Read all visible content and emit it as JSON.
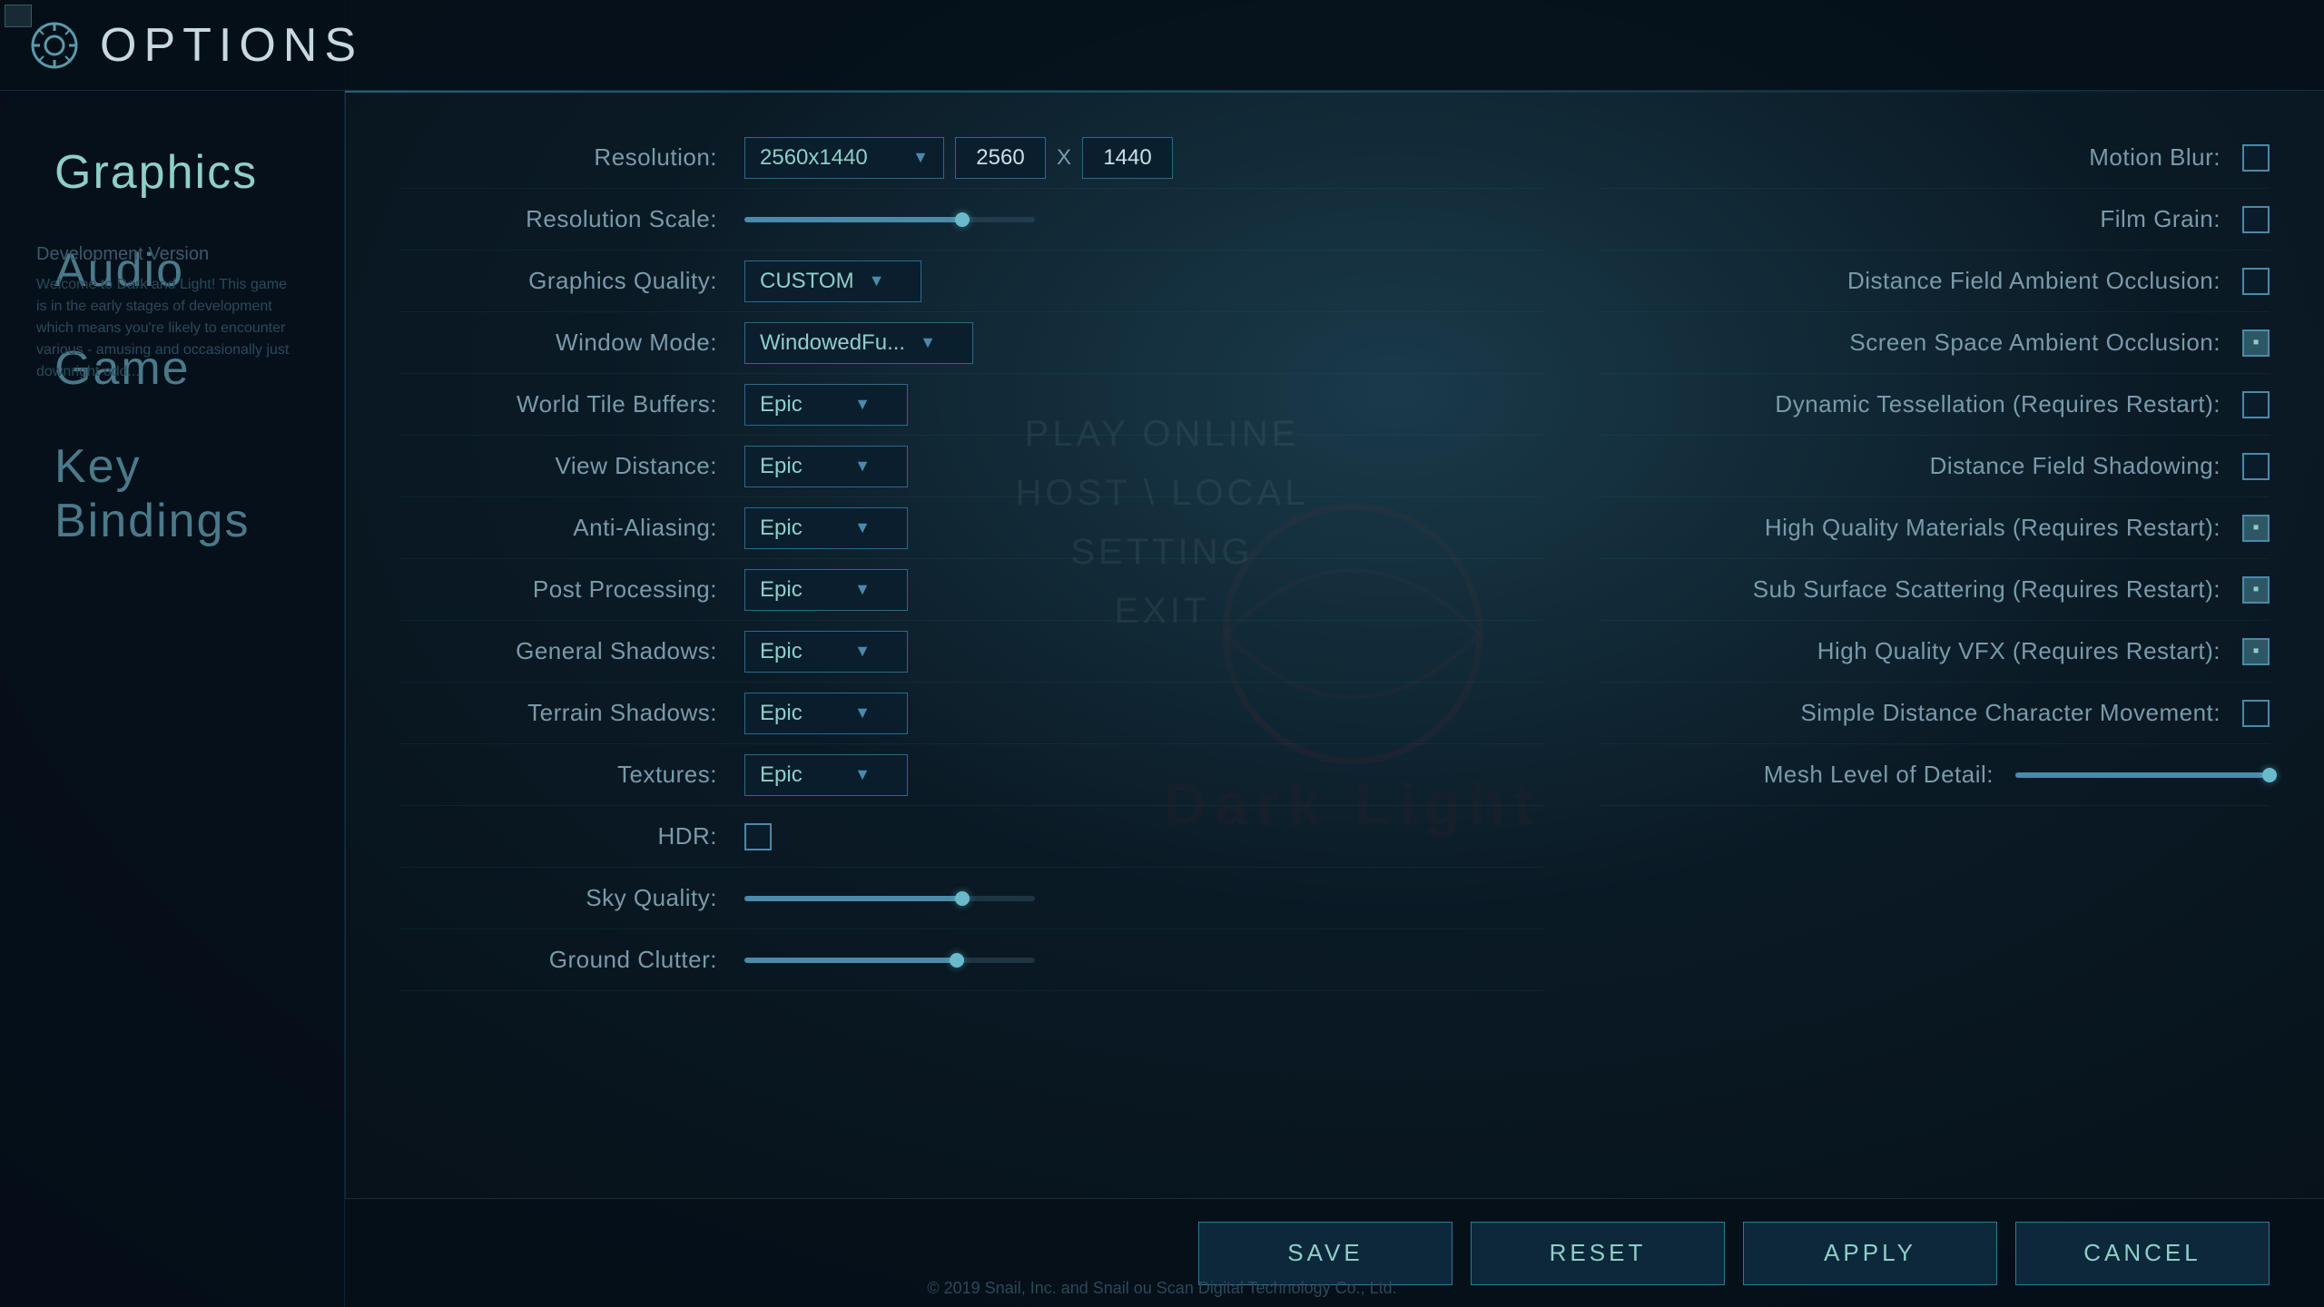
{
  "window": {
    "title": "OPTIONS",
    "icon": "⚙"
  },
  "sidebar": {
    "items": [
      {
        "id": "graphics",
        "label": "Graphics",
        "active": true
      },
      {
        "id": "audio",
        "label": "Audio",
        "active": false
      },
      {
        "id": "game",
        "label": "Game",
        "active": false
      },
      {
        "id": "keybindings",
        "label": "Key Bindings",
        "active": false
      }
    ],
    "dev_note_title": "Development Version",
    "dev_note_body": "Welcome to Dark and Light! This game is in the early stages of development which means you're likely to encounter various - amusing and occasionally just downright odd..."
  },
  "settings_left": {
    "resolution": {
      "label": "Resolution:",
      "dropdown_value": "2560x1440",
      "width": "2560",
      "x_sep": "X",
      "height": "1440"
    },
    "resolution_scale": {
      "label": "Resolution Scale:",
      "slider_pct": 75
    },
    "graphics_quality": {
      "label": "Graphics Quality:",
      "value": "CUSTOM"
    },
    "window_mode": {
      "label": "Window Mode:",
      "value": "WindowedFu..."
    },
    "world_tile_buffers": {
      "label": "World Tile Buffers:",
      "value": "Epic"
    },
    "view_distance": {
      "label": "View Distance:",
      "value": "Epic"
    },
    "anti_aliasing": {
      "label": "Anti-Aliasing:",
      "value": "Epic"
    },
    "post_processing": {
      "label": "Post Processing:",
      "value": "Epic"
    },
    "general_shadows": {
      "label": "General Shadows:",
      "value": "Epic"
    },
    "terrain_shadows": {
      "label": "Terrain Shadows:",
      "value": "Epic"
    },
    "textures": {
      "label": "Textures:",
      "value": "Epic"
    },
    "hdr": {
      "label": "HDR:",
      "checked": false
    },
    "sky_quality": {
      "label": "Sky Quality:",
      "slider_pct": 75
    },
    "ground_clutter": {
      "label": "Ground Clutter:",
      "slider_pct": 73
    }
  },
  "settings_right": {
    "motion_blur": {
      "label": "Motion Blur:",
      "checked": false
    },
    "film_grain": {
      "label": "Film Grain:",
      "checked": false
    },
    "distance_field_ao": {
      "label": "Distance Field Ambient Occlusion:",
      "checked": false
    },
    "screen_space_ao": {
      "label": "Screen Space Ambient Occlusion:",
      "checked": true,
      "partial": true
    },
    "dynamic_tessellation": {
      "label": "Dynamic Tessellation (Requires Restart):",
      "checked": false
    },
    "distance_field_shadowing": {
      "label": "Distance Field Shadowing:",
      "checked": false
    },
    "high_quality_materials": {
      "label": "High Quality Materials (Requires Restart):",
      "checked": true,
      "partial": true
    },
    "sub_surface_scattering": {
      "label": "Sub Surface Scattering (Requires Restart):",
      "checked": true,
      "partial": true
    },
    "high_quality_vfx": {
      "label": "High Quality VFX (Requires Restart):",
      "checked": true,
      "partial": true
    },
    "simple_distance_char": {
      "label": "Simple Distance Character Movement:",
      "checked": false
    },
    "mesh_lod": {
      "label": "Mesh Level of Detail:",
      "slider_pct": 100
    }
  },
  "ghost_menu": {
    "items": [
      "PLAY ONLINE",
      "HOST \\ LOCAL",
      "SETTING",
      "EXIT"
    ]
  },
  "buttons": {
    "save": "SAVE",
    "reset": "RESET",
    "apply": "APPLY",
    "cancel": "CANCEL"
  },
  "watermark": "© 2019 Snail, Inc. and Snail ou Scan Digital Technology Co., Ltd."
}
